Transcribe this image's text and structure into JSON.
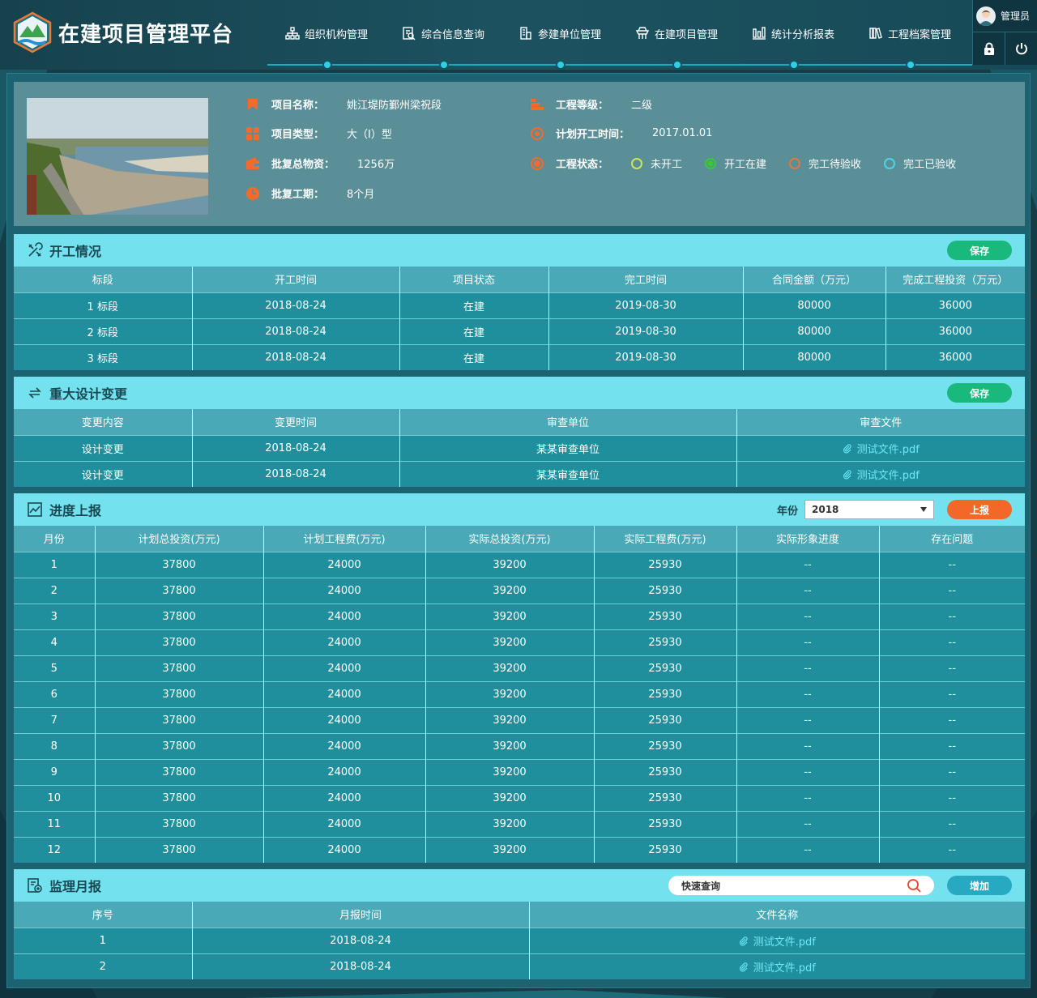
{
  "app": {
    "title": "在建项目管理平台"
  },
  "nav": [
    {
      "label": "组织机构管理",
      "icon": "org-chart-icon"
    },
    {
      "label": "综合信息查询",
      "icon": "document-search-icon"
    },
    {
      "label": "参建单位管理",
      "icon": "building-icon"
    },
    {
      "label": "在建项目管理",
      "icon": "construction-icon"
    },
    {
      "label": "统计分析报表",
      "icon": "bar-chart-icon"
    },
    {
      "label": "工程档案管理",
      "icon": "books-icon"
    }
  ],
  "user": {
    "name": "管理员"
  },
  "project": {
    "name_label": "项目名称：",
    "name_value": "姚江堤防鄞州梁祝段",
    "type_label": "项目类型：",
    "type_value": "大（I）型",
    "investment_label": "批复总物资：",
    "investment_value": "1256万",
    "duration_label": "批复工期：",
    "duration_value": "8个月",
    "grade_label": "工程等级：",
    "grade_value": "二级",
    "start_label": "计划开工时间：",
    "start_value": "2017.01.01",
    "status_label": "工程状态：",
    "status_options": [
      {
        "label": "未开工",
        "color": "#c9e65a"
      },
      {
        "label": "开工在建",
        "color": "#33cc33"
      },
      {
        "label": "完工待验收",
        "color": "#e5763c"
      },
      {
        "label": "完工已验收",
        "color": "#4cd4e6"
      }
    ],
    "selected_status": "开工在建"
  },
  "start_section": {
    "title": "开工情况",
    "save_label": "保存",
    "headers": [
      "标段",
      "开工时间",
      "项目状态",
      "完工时间",
      "合同金额（万元）",
      "完成工程投资（万元）"
    ],
    "rows": [
      [
        "1 标段",
        "2018-08-24",
        "在建",
        "2019-08-30",
        "80000",
        "36000"
      ],
      [
        "2 标段",
        "2018-08-24",
        "在建",
        "2019-08-30",
        "80000",
        "36000"
      ],
      [
        "3 标段",
        "2018-08-24",
        "在建",
        "2019-08-30",
        "80000",
        "36000"
      ]
    ]
  },
  "design_section": {
    "title": "重大设计变更",
    "save_label": "保存",
    "headers": [
      "变更内容",
      "变更时间",
      "审查单位",
      "审查文件"
    ],
    "rows": [
      [
        "设计变更",
        "2018-08-24",
        "某某审查单位",
        "测试文件.pdf"
      ],
      [
        "设计变更",
        "2018-08-24",
        "某某审查单位",
        "测试文件.pdf"
      ]
    ]
  },
  "progress_section": {
    "title": "进度上报",
    "year_label": "年份",
    "year_value": "2018",
    "report_label": "上报",
    "headers": [
      "月份",
      "计划总投资(万元)",
      "计划工程费(万元)",
      "实际总投资(万元)",
      "实际工程费(万元)",
      "实际形象进度",
      "存在问题"
    ],
    "rows": [
      [
        "1",
        "37800",
        "24000",
        "39200",
        "25930",
        "--",
        "--"
      ],
      [
        "2",
        "37800",
        "24000",
        "39200",
        "25930",
        "--",
        "--"
      ],
      [
        "3",
        "37800",
        "24000",
        "39200",
        "25930",
        "--",
        "--"
      ],
      [
        "4",
        "37800",
        "24000",
        "39200",
        "25930",
        "--",
        "--"
      ],
      [
        "5",
        "37800",
        "24000",
        "39200",
        "25930",
        "--",
        "--"
      ],
      [
        "6",
        "37800",
        "24000",
        "39200",
        "25930",
        "--",
        "--"
      ],
      [
        "7",
        "37800",
        "24000",
        "39200",
        "25930",
        "--",
        "--"
      ],
      [
        "8",
        "37800",
        "24000",
        "39200",
        "25930",
        "--",
        "--"
      ],
      [
        "9",
        "37800",
        "24000",
        "39200",
        "25930",
        "--",
        "--"
      ],
      [
        "10",
        "37800",
        "24000",
        "39200",
        "25930",
        "--",
        "--"
      ],
      [
        "11",
        "37800",
        "24000",
        "39200",
        "25930",
        "--",
        "--"
      ],
      [
        "12",
        "37800",
        "24000",
        "39200",
        "25930",
        "--",
        "--"
      ]
    ]
  },
  "monthly_section": {
    "title": "监理月报",
    "search_placeholder": "快速查询",
    "add_label": "增加",
    "headers": [
      "序号",
      "月报时间",
      "文件名称"
    ],
    "rows": [
      [
        "1",
        "2018-08-24",
        "测试文件.pdf"
      ],
      [
        "2",
        "2018-08-24",
        "测试文件.pdf"
      ]
    ]
  }
}
